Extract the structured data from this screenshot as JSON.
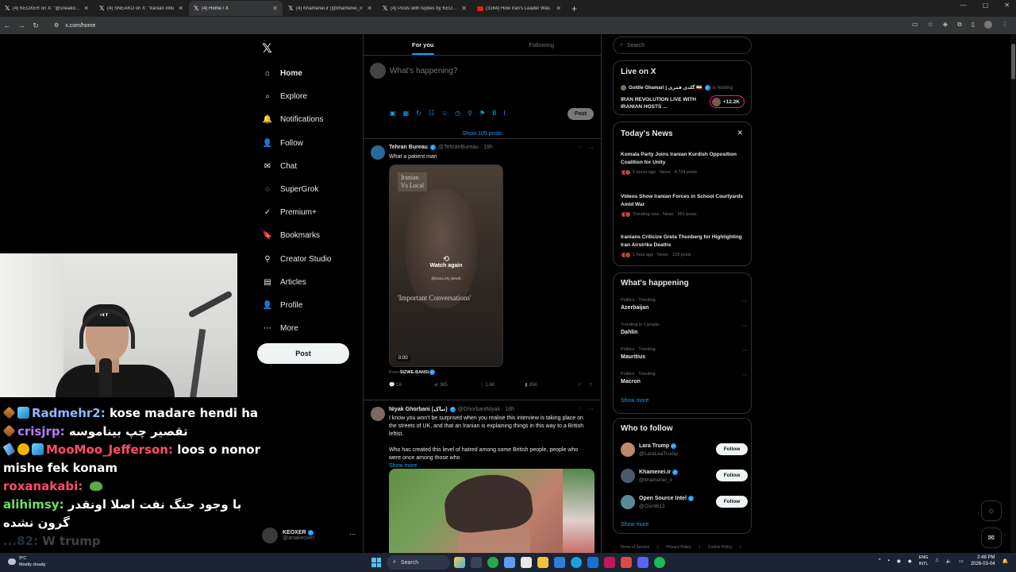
{
  "browser": {
    "tabs": [
      {
        "title": "(4) KEOXER on X: \"@sneako Fre",
        "icon": "x"
      },
      {
        "title": "(4) SNEAKO on X: \"Iranian influ",
        "icon": "x"
      },
      {
        "title": "(4) Home / X",
        "icon": "x",
        "active": true
      },
      {
        "title": "(4) Khamenei.ir (@khamenei_ir",
        "icon": "x"
      },
      {
        "title": "(4) Posts with replies by KEOXE",
        "icon": "x"
      },
      {
        "title": "(3164) How Iran's Leader Was ",
        "icon": "youtube"
      }
    ],
    "url": "x.com/home",
    "new_tab": "+",
    "controls": {
      "minimize": "—",
      "maximize": "▢",
      "close": "✕"
    }
  },
  "sidebar": {
    "logo": "𝕏",
    "items": [
      {
        "label": "Home",
        "icon": "⌂",
        "active": true
      },
      {
        "label": "Explore",
        "icon": "⌕"
      },
      {
        "label": "Notifications",
        "icon": "🔔"
      },
      {
        "label": "Follow",
        "icon": "👤"
      },
      {
        "label": "Chat",
        "icon": "✉"
      },
      {
        "label": "SuperGrok",
        "icon": "◌"
      },
      {
        "label": "Premium+",
        "icon": "✓"
      },
      {
        "label": "Bookmarks",
        "icon": "🔖"
      },
      {
        "label": "Creator Studio",
        "icon": "⚲"
      },
      {
        "label": "Articles",
        "icon": "▤"
      },
      {
        "label": "Profile",
        "icon": "👤"
      },
      {
        "label": "More",
        "icon": "⋯"
      }
    ],
    "post_label": "Post",
    "account": {
      "name": "KEOXER",
      "handle": "@ariakeoxer",
      "more": "⋯"
    }
  },
  "feed": {
    "tabs": [
      "For you",
      "Following"
    ],
    "compose_placeholder": "What's happening?",
    "compose_tools": [
      "▣",
      "▦",
      "↻",
      "☷",
      "☺",
      "◷",
      "⚲",
      "⚑",
      "B",
      "I"
    ],
    "post_button": "Post",
    "show_posts": "Show 105 posts",
    "tweets": [
      {
        "name": "Tehran Bureau",
        "handle": "@TehranBureau · 19h",
        "text": "What a patient man",
        "video": {
          "caption_top": "Iranian\nVs Local",
          "caption_bottom": "'Important Conversations'",
          "overlay_handle": "@CULLAN_MAVE",
          "watch_again": "Watch again",
          "time": "0:00"
        },
        "from_label": "From",
        "from_name": "SIZWE-BANSI",
        "actions": {
          "replies": "16",
          "reposts": "365",
          "likes": "1.6K",
          "views": "35K"
        }
      },
      {
        "name": "Niyak Ghorbani (نیاک)",
        "handle": "@GhorbaniNiyak · 18h",
        "text1": "I know you won't be surprised when you realise this interview is taking place on the streets of UK, and that an Iranian is explaining things in this way to a British leftist.",
        "text2": "Who has created this level of hatred among some British people, people who were once among those who",
        "show_more": "Show more"
      }
    ]
  },
  "right": {
    "search_placeholder": "Search",
    "live": {
      "title": "Live on X",
      "host_name": "Goldie Ghamari | گلدی قمری 🇮🇷",
      "host_suffix": "is hosting",
      "stream_title": "IRAN REVOLUTION LIVE WITH IRANIAN HOSTS ...",
      "count": "+12.2K"
    },
    "news": {
      "title": "Today's News",
      "close": "✕",
      "items": [
        {
          "title": "Komala Party Joins Iranian Kurdish Opposition Coalition for Unity",
          "meta": "6 hours ago · News · 4,724 posts"
        },
        {
          "title": "Videos Show Iranian Forces in School Courtyards Amid War",
          "meta": "Trending now · News · 951 posts"
        },
        {
          "title": "Iranians Criticize Greta Thunberg for Highlighting Iran Airstrike Deaths",
          "meta": "1 hour ago · News · 133 posts"
        }
      ]
    },
    "happening": {
      "title": "What's happening",
      "trends": [
        {
          "context": "Politics · Trending",
          "name": "Azerbaijan"
        },
        {
          "context": "Trending in Canada",
          "name": "Dahlin"
        },
        {
          "context": "Politics · Trending",
          "name": "Mauritius"
        },
        {
          "context": "Politics · Trending",
          "name": "Macron"
        }
      ],
      "show_more": "Show more"
    },
    "who_to_follow": {
      "title": "Who to follow",
      "users": [
        {
          "name": "Lara Trump",
          "handle": "@LaraLeaTrump"
        },
        {
          "name": "Khamenei.ir",
          "handle": "@khamenei_ir"
        },
        {
          "name": "Open Source Intel",
          "handle": "@Osint613"
        }
      ],
      "follow_label": "Follow",
      "show_more": "Show more"
    },
    "footer": [
      "Terms of Service",
      "|",
      "Privacy Policy",
      "|",
      "Cookie Policy",
      "|"
    ]
  },
  "overlay": {
    "chat": [
      {
        "user": "Radmehr2",
        "color": "#8fb8ff",
        "message": "kose madare hendi ha",
        "badges": [
          "diamond",
          "cube"
        ]
      },
      {
        "user": "crisjrp",
        "color": "#b77bff",
        "message": "تقصیر چپ بیناموسه",
        "badges": [
          "diamond"
        ]
      },
      {
        "user": "MooMoo_Jefferson",
        "color": "#ff4d6a",
        "message": "loos o nonor mishe fek konam",
        "badges": [
          "sword",
          "coin",
          "cube"
        ]
      },
      {
        "user": "roxanakabi",
        "color": "#ff4d6a",
        "message": "",
        "badges": [],
        "emote": "frog"
      },
      {
        "user": "alihimsy",
        "color": "#6fe05a",
        "message": "با وجود جنگ نفت اصلا اونقدر گرون نشده",
        "badges": []
      },
      {
        "user": "...82",
        "color": "#8fb8ff",
        "message": "W trump",
        "badges": []
      }
    ],
    "cam_logo": "NY"
  },
  "taskbar": {
    "weather_temp": "9°C",
    "weather_desc": "Mostly cloudy",
    "search": "Search",
    "lang1": "ENG",
    "lang2": "INTL",
    "time": "2:48 PM",
    "date": "2026-03-04"
  },
  "colors": {
    "accent": "#1d9bf0",
    "border": "#2f3336",
    "muted": "#71767b",
    "live": "#f91880"
  }
}
